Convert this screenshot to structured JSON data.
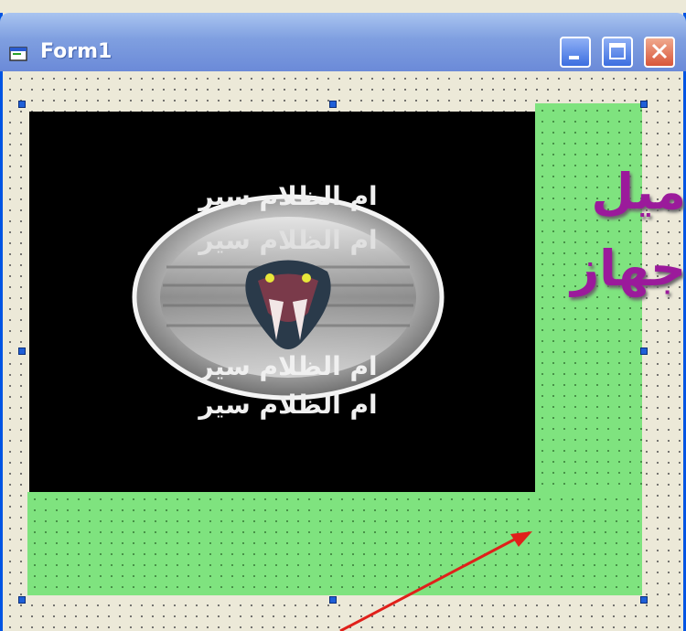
{
  "window": {
    "title": "Form1",
    "controls": [
      "minimize",
      "maximize",
      "close"
    ]
  },
  "logo": {
    "arabic_line_1": "ام الظلام سير",
    "arabic_line_2": "ام الظلام سير",
    "arabic_line_3": "ام الظلام سير",
    "arabic_line_4": "ام الظلام سير"
  },
  "side_text": {
    "line_1": "ميل",
    "line_2": "جهاز"
  },
  "colors": {
    "green_control": "#7fe37f",
    "arrow": "#e0201a",
    "side_text": "#9b1a9b"
  }
}
